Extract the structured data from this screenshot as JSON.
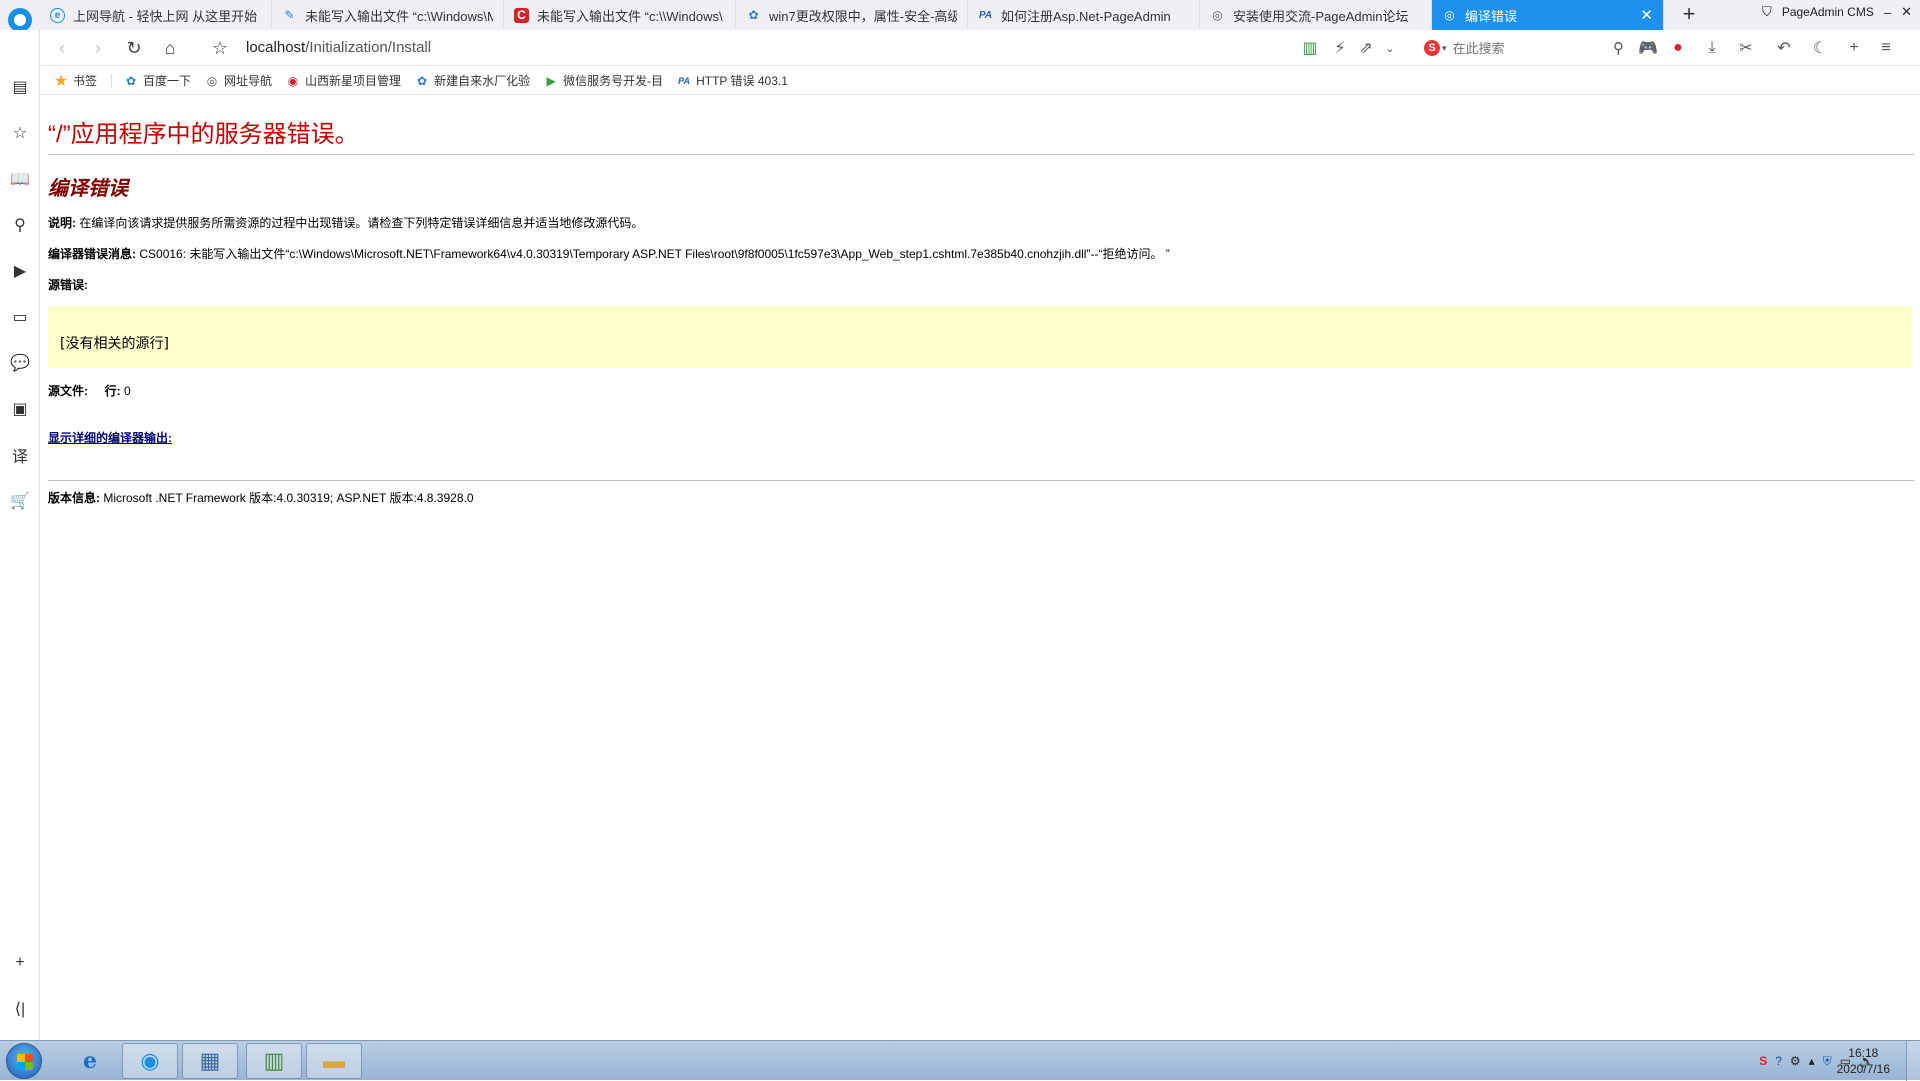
{
  "browser": {
    "tabs": [
      {
        "label": "上网导航 - 轻快上网 从这里开始",
        "icon": "e-icon",
        "active": false
      },
      {
        "label": "未能写入输出文件 “c:\\Windows\\M",
        "icon": "doc-icon",
        "active": false
      },
      {
        "label": "未能写入输出文件 “c:\\\\Windows\\",
        "icon": "c-icon",
        "active": false
      },
      {
        "label": "win7更改权限中，属性-安全-高级",
        "icon": "paw-icon",
        "active": false
      },
      {
        "label": "如何注册Asp.Net-PageAdmin",
        "icon": "pa-icon",
        "active": false
      },
      {
        "label": "安装使用交流-PageAdmin论坛",
        "icon": "globe-icon",
        "active": false
      },
      {
        "label": "编译错误",
        "icon": "globe-icon",
        "active": true
      }
    ],
    "window_title": "PageAdmin CMS",
    "address": {
      "host": "localhost",
      "path": "/Initialization/Install"
    },
    "search_placeholder": "在此搜索",
    "bookmarks": [
      {
        "label": "书签",
        "icon": "star-icon"
      },
      {
        "label": "百度一下",
        "icon": "paw-icon"
      },
      {
        "label": "网址导航",
        "icon": "globe-icon"
      },
      {
        "label": "山西新星项目管理",
        "icon": "circle-icon"
      },
      {
        "label": "新建自来水厂化验",
        "icon": "paw-icon"
      },
      {
        "label": "微信服务号开发-目",
        "icon": "play-icon"
      },
      {
        "label": "HTTP 错误 403.1",
        "icon": "pa-icon"
      }
    ]
  },
  "page": {
    "title": "“/”应用程序中的服务器错误。",
    "subtitle": "编译错误",
    "description_label": "说明:",
    "description_text": "在编译向该请求提供服务所需资源的过程中出现错误。请检查下列特定错误详细信息并适当地修改源代码。",
    "compiler_msg_label": "编译器错误消息:",
    "compiler_msg_text": "CS0016: 未能写入输出文件“c:\\Windows\\Microsoft.NET\\Framework64\\v4.0.30319\\Temporary ASP.NET Files\\root\\9f8f0005\\1fc597e3\\App_Web_step1.cshtml.7e385b40.cnohzjih.dll”--“拒绝访问。 ”",
    "source_error_label": "源错误:",
    "source_error_text": "[没有相关的源行]",
    "source_file_label": "源文件:",
    "line_label": "行:",
    "line_value": "0",
    "detail_link": "显示详细的编译器输出:",
    "version_label": "版本信息:",
    "version_text": "Microsoft .NET Framework 版本:4.0.30319; ASP.NET 版本:4.8.3928.0"
  },
  "taskbar": {
    "time": "16:18",
    "date": "2020/7/16"
  }
}
